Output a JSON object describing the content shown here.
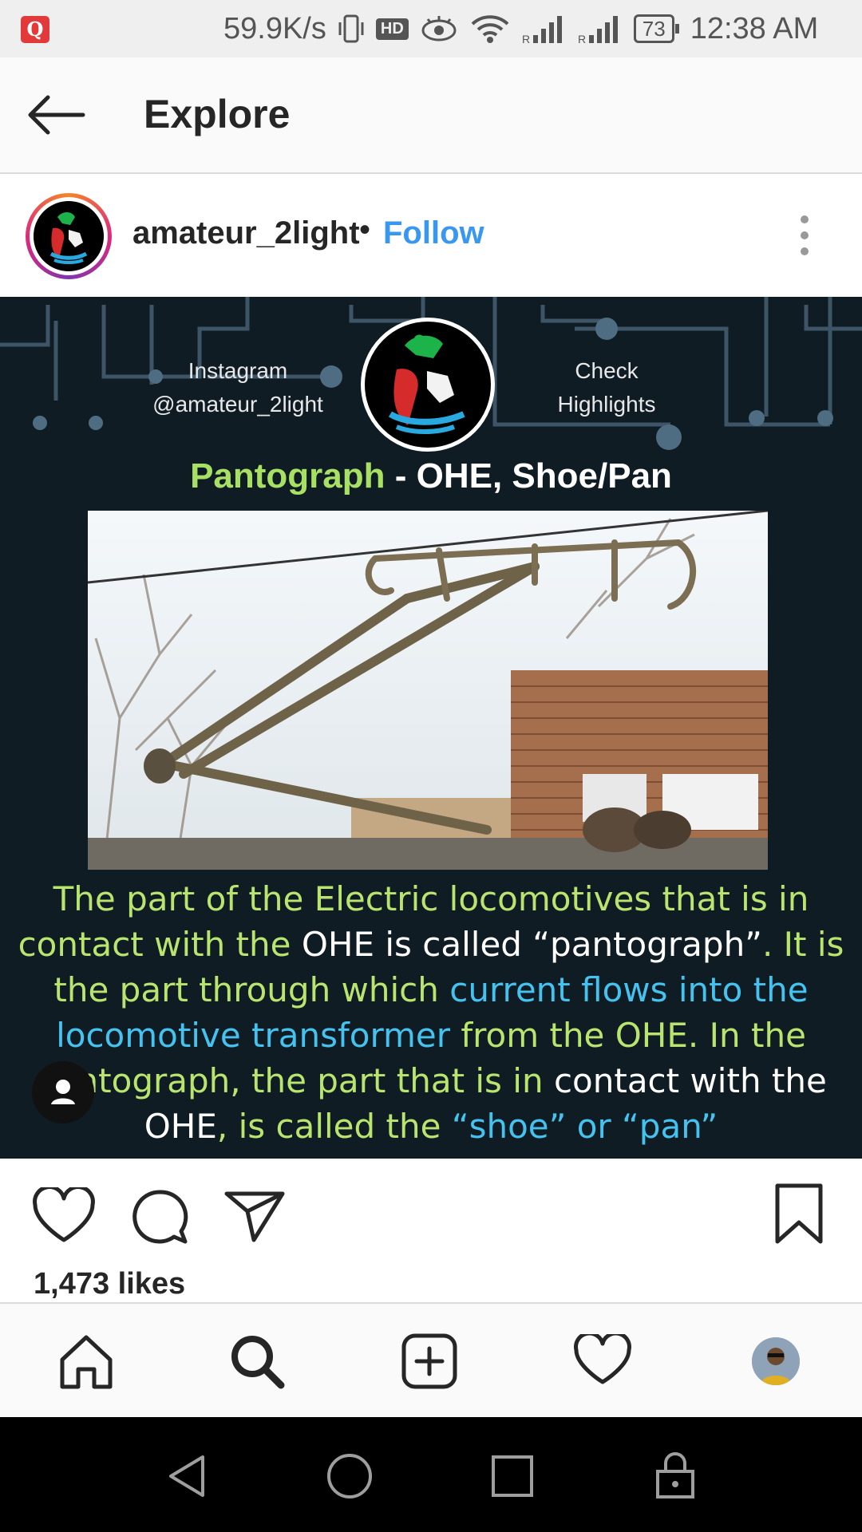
{
  "status_bar": {
    "app_badge": "Q",
    "network_speed": "59.9K/s",
    "hd_badge": "HD",
    "battery": "73",
    "time": "12:38 AM"
  },
  "header": {
    "title": "Explore",
    "back_icon": "arrow-left-icon"
  },
  "post": {
    "username": "amateur_2light",
    "separator": "•",
    "follow_label": "Follow",
    "image": {
      "instagram_label_line1": "Instagram",
      "instagram_label_line2": "@amateur_2light",
      "check_label_line1": "Check",
      "check_label_line2": "Highlights",
      "heading_green": "Pantograph",
      "heading_dash": " - ",
      "heading_white": "OHE, Shoe/Pan",
      "caption": {
        "s1": "The part of the Electric locomotives that is in contact with the ",
        "s2": "OHE",
        "s3": " is called “pantograph”",
        "s4": ". It is the part through which ",
        "s5": "current flows into the locomotive transformer",
        "s6": " from the OHE. In the pantograph, the part that is in ",
        "s7": "contact with the OHE",
        "s8": ", is called the ",
        "s9": "“shoe” or “pan”"
      }
    },
    "likes": "1,473 likes"
  },
  "colors": {
    "follow_blue": "#3897f0",
    "post_bg": "#0f1c24",
    "caption_green": "#b9e56f",
    "caption_blue": "#45c3f0"
  }
}
